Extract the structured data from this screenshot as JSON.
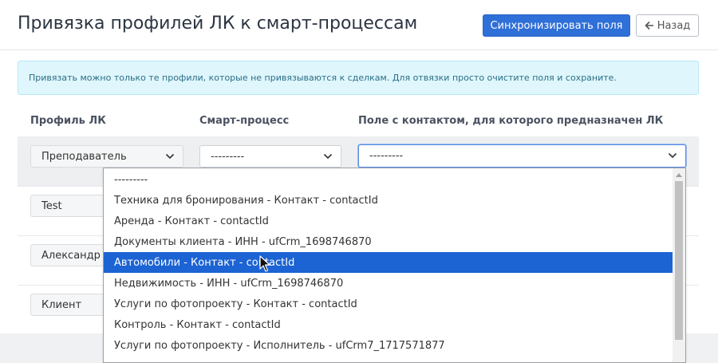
{
  "header": {
    "title": "Привязка профилей ЛК к смарт-процессам",
    "sync_button": "Синхронизировать поля",
    "back_button": "Назад"
  },
  "alert": {
    "text": "Привязать можно только те профили, которые не привязываются к сделкам. Для отвязки просто очистите поля и сохраните."
  },
  "table": {
    "columns": [
      "Профиль ЛК",
      "Смарт-процесс",
      "Поле с контактом, для которого предназначен ЛК"
    ],
    "rows": [
      {
        "profile": "Преподаватель",
        "smart_process": "---------",
        "contact_field": "---------"
      },
      {
        "profile": "Test"
      },
      {
        "profile": "Александр И"
      },
      {
        "profile": "Клиент"
      }
    ]
  },
  "dropdown": {
    "options": [
      "---------",
      "Техника для бронирования - Контакт - contactId",
      "Аренда - Контакт - contactId",
      "Документы клиента - ИНН - ufCrm_1698746870",
      "Автомобили - Контакт - contactId",
      "Недвижимость - ИНН - ufCrm_1698746870",
      "Услуги по фотопроекту - Контакт - contactId",
      "Контроль - Контакт - contactId",
      "Услуги по фотопроекту - Исполнитель - ufCrm7_1717571877"
    ],
    "selected_index": 4
  },
  "colors": {
    "primary": "#2f6fd8",
    "selected": "#1c63d3",
    "alert_bg": "#dff6fd",
    "alert_text": "#2a6f85"
  },
  "icons": [
    "arrow-left-icon",
    "chevron-down-icon",
    "mouse-cursor-icon"
  ]
}
